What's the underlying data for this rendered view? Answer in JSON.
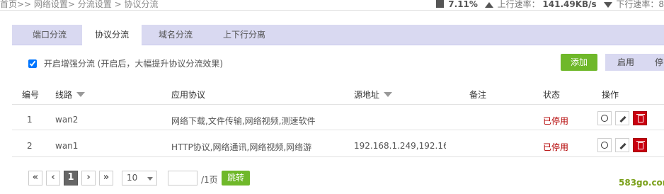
{
  "topbar": {
    "breadcrumb": "首页>>  网络设置>  分流设置 >  协议分流",
    "cpu_value": "7.11%",
    "upload_label": "上行速率：",
    "upload_value": "141.49KB/s",
    "download_label": "下行速率：8"
  },
  "tabs": [
    {
      "label": "端口分流"
    },
    {
      "label": "协议分流",
      "active": true
    },
    {
      "label": "域名分流"
    },
    {
      "label": "上下行分离"
    }
  ],
  "enhance_checkbox": {
    "checked": true,
    "label": "开启增强分流  (开启后，大幅提升协议分流效果)"
  },
  "buttons": {
    "add": "添加",
    "enable": "启用",
    "disable": "停"
  },
  "table": {
    "headers": [
      "编号",
      "线路",
      "应用协议",
      "源地址",
      "备注",
      "状态",
      "操作"
    ],
    "rows": [
      {
        "no": "1",
        "line": "wan2",
        "protocol": "网络下载,文件传输,网络视频,测速软件",
        "source": "",
        "note": "",
        "status": "已停用"
      },
      {
        "no": "2",
        "line": "wan1",
        "protocol": "HTTP协议,网络通讯,网络视频,网络游",
        "source": "192.168.1.249,192.16",
        "note": "",
        "status": "已停用"
      }
    ]
  },
  "pagination": {
    "first": "«",
    "prev": "‹",
    "current": "1",
    "next": "›",
    "last": "»",
    "page_size": "10",
    "total": "/1页",
    "jump": "跳转"
  },
  "watermark": "583go.com",
  "colors": {
    "accent_green": "#6fb82a",
    "tab_bg": "#d9d9f1",
    "status_off": "#b30000",
    "delete_red": "#c9000f"
  }
}
